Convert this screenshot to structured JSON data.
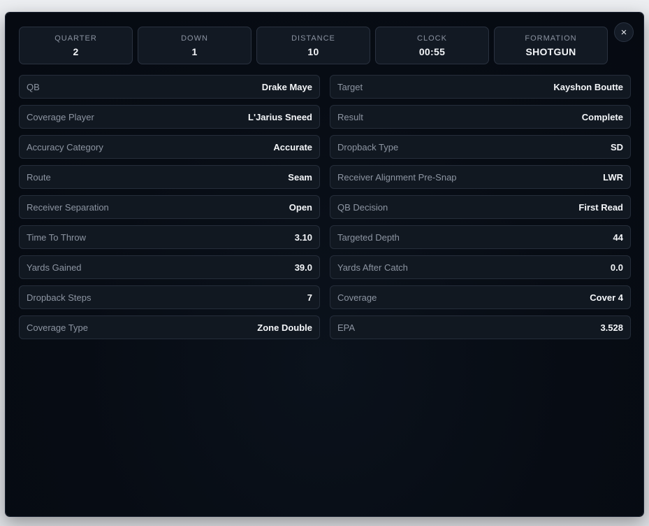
{
  "close_label": "×",
  "stats": [
    {
      "label": "QUARTER",
      "value": "2"
    },
    {
      "label": "DOWN",
      "value": "1"
    },
    {
      "label": "DISTANCE",
      "value": "10"
    },
    {
      "label": "CLOCK",
      "value": "00:55"
    },
    {
      "label": "FORMATION",
      "value": "SHOTGUN"
    }
  ],
  "rows": [
    {
      "label": "QB",
      "value": "Drake Maye"
    },
    {
      "label": "Target",
      "value": "Kayshon Boutte"
    },
    {
      "label": "Coverage Player",
      "value": "L'Jarius Sneed"
    },
    {
      "label": "Result",
      "value": "Complete"
    },
    {
      "label": "Accuracy Category",
      "value": "Accurate"
    },
    {
      "label": "Dropback Type",
      "value": "SD"
    },
    {
      "label": "Route",
      "value": "Seam"
    },
    {
      "label": "Receiver Alignment Pre-Snap",
      "value": "LWR"
    },
    {
      "label": "Receiver Separation",
      "value": "Open"
    },
    {
      "label": "QB Decision",
      "value": "First Read"
    },
    {
      "label": "Time To Throw",
      "value": "3.10"
    },
    {
      "label": "Targeted Depth",
      "value": "44"
    },
    {
      "label": "Yards Gained",
      "value": "39.0"
    },
    {
      "label": "Yards After Catch",
      "value": "0.0"
    },
    {
      "label": "Dropback Steps",
      "value": "7"
    },
    {
      "label": "Coverage",
      "value": "Cover 4"
    },
    {
      "label": "Coverage Type",
      "value": "Zone Double"
    },
    {
      "label": "EPA",
      "value": "3.528"
    }
  ]
}
